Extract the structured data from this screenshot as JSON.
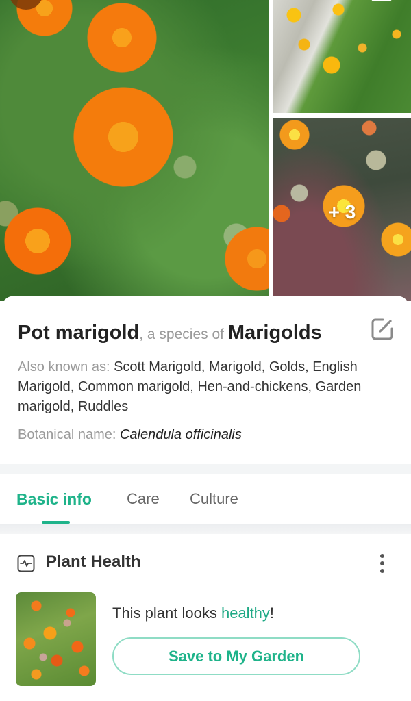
{
  "gallery": {
    "more_photos_label": "+ 3"
  },
  "plant": {
    "common_name": "Pot marigold",
    "species_connector": ", a species of ",
    "genus_name": "Marigolds",
    "also_known_label": "Also known as: ",
    "also_known_values": "Scott Marigold, Marigold, Golds, English Marigold, Common marigold, Hen-and-chickens, Garden marigold, Ruddles",
    "botanical_label": "Botanical name: ",
    "botanical_value": "Calendula officinalis"
  },
  "icons": {
    "edit": "edit-icon",
    "health": "health-pulse-icon",
    "more": "more-vertical-icon"
  },
  "tabs": [
    {
      "label": "Basic info",
      "active": true
    },
    {
      "label": "Care",
      "active": false
    },
    {
      "label": "Culture",
      "active": false
    }
  ],
  "health": {
    "title": "Plant Health",
    "status_prefix": "This plant looks ",
    "status_value": "healthy",
    "status_suffix": "!",
    "save_button_label": "Save to My Garden"
  },
  "colors": {
    "accent": "#1fb38a",
    "button_border": "#8fdcc5",
    "muted_text": "#9a9a9a"
  }
}
